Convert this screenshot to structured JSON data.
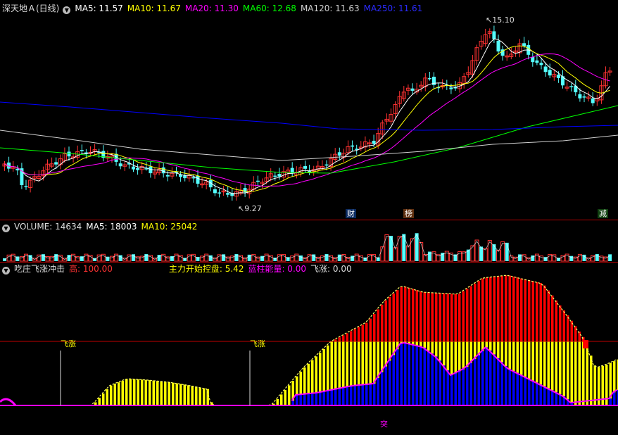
{
  "main_legend": {
    "title": "深天地Ａ(日线)",
    "ma5": "MA5: 11.57",
    "ma10": "MA10: 11.67",
    "ma20": "MA20: 11.30",
    "ma60": "MA60: 12.68",
    "ma120": "MA120: 11.63",
    "ma250": "MA250: 11.61"
  },
  "price_labels": {
    "high": "15.10",
    "low": "9.27"
  },
  "event_tags": [
    "财",
    "榜",
    "减"
  ],
  "volume_legend": {
    "title": "VOLUME: 14634",
    "ma5": "MA5: 18003",
    "ma10": "MA10: 25042"
  },
  "indicator_legend": {
    "name": "吃庄飞涨冲击",
    "high": "高: 100.00",
    "control": "主力开始控盘: 5.42",
    "blue_energy": "蓝柱能量: 0.00",
    "surge": "飞涨: 0.00"
  },
  "markers": {
    "surge_1": "飞涨",
    "surge_2": "飞涨",
    "breakout": "突"
  },
  "colors": {
    "up": "#ff3232",
    "down": "#54ffff",
    "ma5": "#ffffff",
    "ma10": "#ffff00",
    "ma20": "#ff00ff",
    "ma60": "#00ff00",
    "ma120": "#d0d0d0",
    "ma250": "#0000ff",
    "red_bar": "#ff0000",
    "yellow_bar": "#ffff00",
    "blue_bar": "#0000ff"
  }
}
